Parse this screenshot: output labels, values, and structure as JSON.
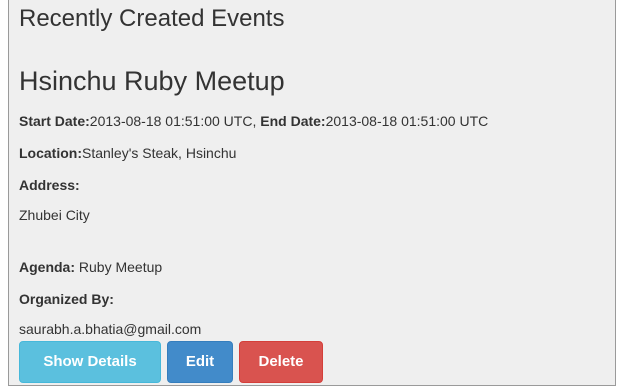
{
  "section": {
    "heading": "Recently Created Events"
  },
  "event": {
    "title": "Hsinchu Ruby Meetup",
    "start_date_label": "Start Date:",
    "start_date": "2013-08-18 01:51:00 UTC",
    "separator": ", ",
    "end_date_label": "End Date:",
    "end_date": "2013-08-18 01:51:00 UTC",
    "location_label": "Location:",
    "location": "Stanley's Steak, Hsinchu",
    "address_label": "Address:",
    "address": "Zhubei City",
    "agenda_label": "Agenda:",
    "agenda": " Ruby Meetup",
    "organizer_label": "Organized By:",
    "organizer_email": "saurabh.a.bhatia@gmail.com"
  },
  "actions": {
    "show_details_label": "Show Details",
    "edit_label": "Edit",
    "delete_label": "Delete"
  },
  "colors": {
    "info": "#5bc0de",
    "primary": "#428bca",
    "danger": "#d9534f",
    "panel_background": "#efefef"
  }
}
